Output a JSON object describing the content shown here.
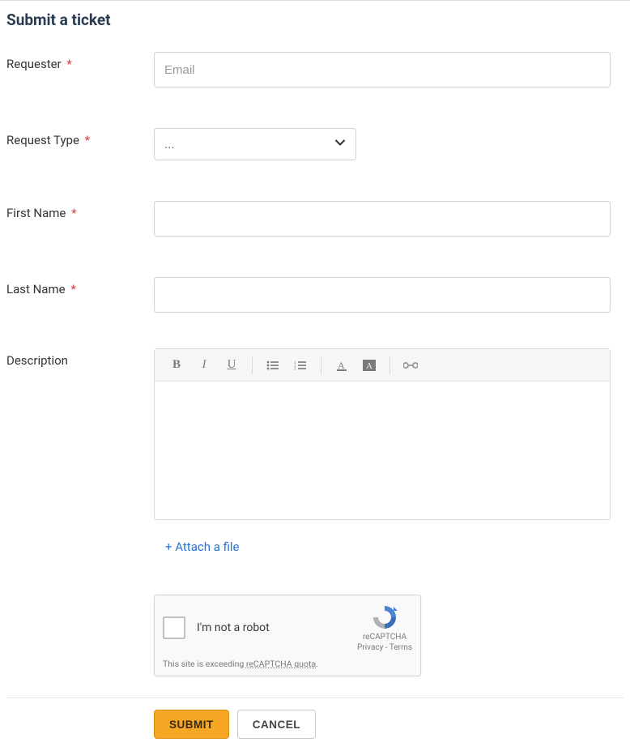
{
  "title": "Submit a ticket",
  "fields": {
    "requester": {
      "label": "Requester",
      "required": true,
      "placeholder": "Email",
      "value": ""
    },
    "request_type": {
      "label": "Request Type",
      "required": true,
      "selected": "..."
    },
    "first_name": {
      "label": "First Name",
      "required": true,
      "value": ""
    },
    "last_name": {
      "label": "Last Name",
      "required": true,
      "value": ""
    },
    "description": {
      "label": "Description",
      "required": false,
      "value": ""
    }
  },
  "editor_toolbar": {
    "bold": "B",
    "italic": "I",
    "underline": "U",
    "ul": "bulleted list",
    "ol": "numbered list",
    "color": "text color",
    "bgcolor": "background color",
    "link": "insert link"
  },
  "attach": {
    "label": "+ Attach a file"
  },
  "captcha": {
    "label": "I'm not a robot",
    "brand": "reCAPTCHA",
    "privacy": "Privacy",
    "terms": "Terms",
    "warning_prefix": "This site is exceeding ",
    "warning_link": "reCAPTCHA quota",
    "warning_suffix": "."
  },
  "buttons": {
    "submit": "SUBMIT",
    "cancel": "CANCEL"
  },
  "required_marker": "*"
}
